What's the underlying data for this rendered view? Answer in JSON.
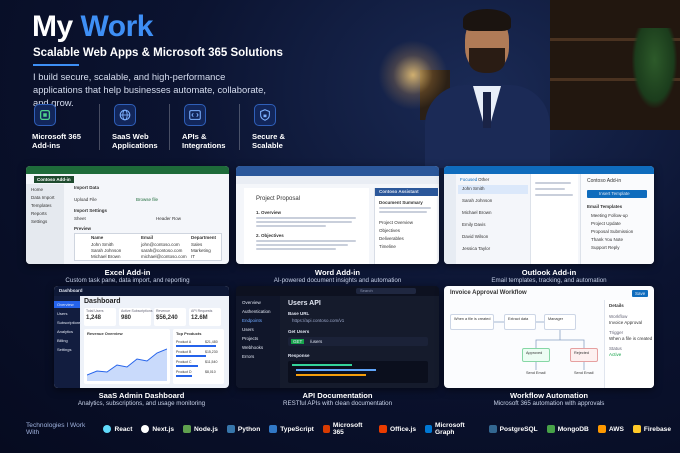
{
  "hero": {
    "title_part1": "My",
    "title_part2": "Work",
    "subtitle": "Scalable Web Apps & Microsoft 365 Solutions",
    "tagline": "I build secure, scalable, and high-performance applications that help businesses automate, collaborate, and grow.",
    "accent_color": "#3e8ff5",
    "features": [
      {
        "icon": "microsoft-365-icon",
        "label": "Microsoft 365 Add-ins"
      },
      {
        "icon": "globe-icon",
        "label": "SaaS Web Applications"
      },
      {
        "icon": "code-icon",
        "label": "APIs & Integrations"
      },
      {
        "icon": "shield-lock-icon",
        "label": "Secure & Scalable"
      }
    ]
  },
  "projects": [
    {
      "title": "Excel Add-in",
      "description": "Custom task pane, data import, and reporting",
      "screen": {
        "app": "Contoso Add-in",
        "heading": "Import Data",
        "nav": [
          "Home",
          "Data Import",
          "Templates",
          "Reports",
          "Settings"
        ],
        "fields": [
          "Upload File",
          "Import Settings",
          "Sheet",
          "Header Row",
          "Preview"
        ],
        "browse": "Browse file",
        "columns": [
          "Name",
          "Email",
          "Department"
        ],
        "rows": [
          [
            "John Smith",
            "john@contoso.com",
            "Sales"
          ],
          [
            "Sarah Johnson",
            "sarah@contoso.com",
            "Marketing"
          ],
          [
            "Michael Brown",
            "michael@contoso.com",
            "IT"
          ]
        ]
      }
    },
    {
      "title": "Word Add-in",
      "description": "AI-powered document insights and automation",
      "screen": {
        "doc_title": "Project Proposal",
        "sections": [
          "1. Overview",
          "2. Objectives"
        ],
        "pane_title": "Contoso Assistant",
        "pane_heading": "Document Summary",
        "pane_items": [
          "Project Overview",
          "Objectives",
          "Deliverables",
          "Timeline"
        ]
      }
    },
    {
      "title": "Outlook Add-in",
      "description": "Email templates, tracking, and automation",
      "screen": {
        "pane_title": "Contoso Add-in",
        "button": "Insert Template",
        "templates_heading": "Email Templates",
        "templates": [
          "Meeting Follow-up",
          "Project Update",
          "Proposal Submission",
          "Thank You Note",
          "Support Reply"
        ],
        "senders": [
          "John Smith",
          "Sarah Johnson",
          "Michael Brown",
          "Emily Davis",
          "David Wilson",
          "Jessica Taylor"
        ],
        "tabs": [
          "Focused",
          "Other"
        ]
      }
    },
    {
      "title": "SaaS Admin Dashboard",
      "description": "Analytics, subscriptions, and usage monitoring",
      "screen": {
        "app": "Dashboard",
        "heading": "Dashboard",
        "nav": [
          "Overview",
          "Users",
          "Subscriptions",
          "Analytics",
          "Billing",
          "Settings"
        ],
        "kpis": [
          {
            "label": "Total Users",
            "value": "1,248"
          },
          {
            "label": "Active Subscriptions",
            "value": "980"
          },
          {
            "label": "Revenue",
            "value": "$56,240"
          },
          {
            "label": "API Requests",
            "value": "12.6M"
          }
        ],
        "chart_title": "Revenue Overview",
        "top_title": "Top Products",
        "products": [
          {
            "name": "Product A",
            "value": "$21,480"
          },
          {
            "name": "Product B",
            "value": "$15,230"
          },
          {
            "name": "Product C",
            "value": "$11,540"
          },
          {
            "name": "Product D",
            "value": "$8,010"
          }
        ]
      }
    },
    {
      "title": "API Documentation",
      "description": "RESTful APIs with clean documentation",
      "screen": {
        "heading": "Users API",
        "nav": [
          "Overview",
          "Authentication",
          "Endpoints",
          "Users",
          "Projects",
          "Webhooks",
          "Errors"
        ],
        "base_url_label": "Base URL",
        "base_url": "https://api.contoso.com/v1",
        "endpoint": "Get Users",
        "method": "GET",
        "path": "/users",
        "response": "Response",
        "search": "Search"
      }
    },
    {
      "title": "Workflow Automation",
      "description": "Microsoft 365 automation with approvals",
      "screen": {
        "heading": "Invoice Approval Workflow",
        "save": "Save",
        "nodes": [
          "When a file is created",
          "Extract data",
          "Manager",
          "Approved",
          "Rejected",
          "Send Email",
          "Send Email"
        ],
        "details_title": "Details",
        "details": [
          "Workflow",
          "Invoice Approval",
          "Trigger",
          "When a file is created",
          "Status",
          "Active"
        ]
      }
    }
  ],
  "technologies": {
    "heading": "Technologies I Work With",
    "items": [
      {
        "name": "React",
        "color": "#61dafb"
      },
      {
        "name": "Next.js",
        "color": "#ffffff"
      },
      {
        "name": "Node.js",
        "color": "#5fa04e"
      },
      {
        "name": "Python",
        "color": "#3776ab"
      },
      {
        "name": "TypeScript",
        "color": "#3178c6"
      },
      {
        "name": "Microsoft 365",
        "color": "#d83b01"
      },
      {
        "name": "Office.js",
        "color": "#eb3c00"
      },
      {
        "name": "Microsoft Graph",
        "color": "#0078d4"
      },
      {
        "name": "PostgreSQL",
        "color": "#336791"
      },
      {
        "name": "MongoDB",
        "color": "#47a248"
      },
      {
        "name": "AWS",
        "color": "#ff9900"
      },
      {
        "name": "Firebase",
        "color": "#ffca28"
      }
    ]
  }
}
